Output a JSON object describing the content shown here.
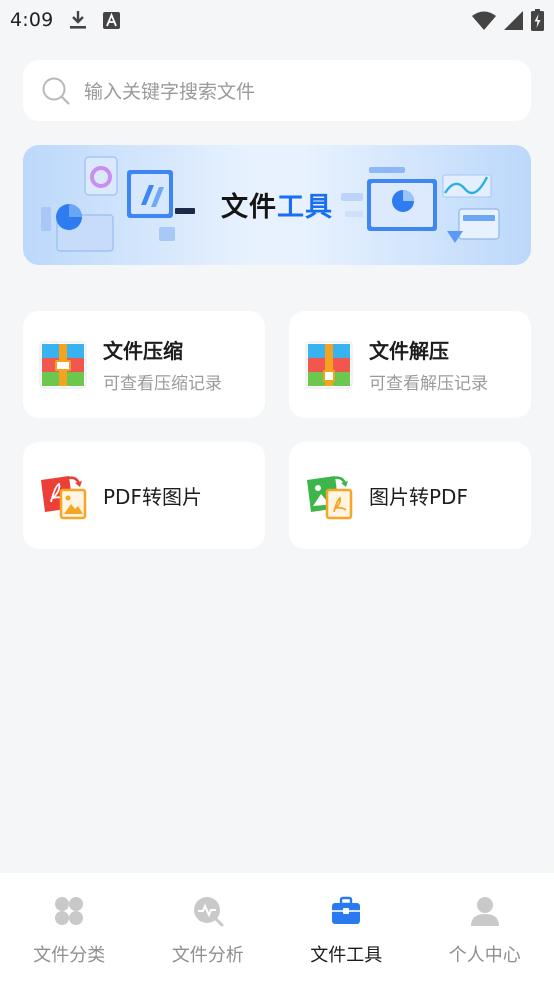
{
  "status_bar": {
    "time": "4:09",
    "icons": [
      "download-icon",
      "a-badge-icon",
      "wifi-icon",
      "signal-icon",
      "battery-charging-icon"
    ]
  },
  "search": {
    "placeholder": "输入关键字搜索文件"
  },
  "banner": {
    "title_part1": "文件",
    "title_part2": "工具"
  },
  "tools": [
    {
      "title": "文件压缩",
      "subtitle": "可查看压缩记录",
      "icon": "archive-compress-icon"
    },
    {
      "title": "文件解压",
      "subtitle": "可查看解压记录",
      "icon": "archive-extract-icon"
    },
    {
      "title": "PDF转图片",
      "icon": "pdf-to-image-icon"
    },
    {
      "title": "图片转PDF",
      "icon": "image-to-pdf-icon"
    }
  ],
  "nav": {
    "active": "文件工具",
    "items": [
      {
        "label": "文件分类",
        "icon": "category-grid-icon"
      },
      {
        "label": "文件分析",
        "icon": "analysis-icon"
      },
      {
        "label": "文件工具",
        "icon": "toolbox-icon"
      },
      {
        "label": "个人中心",
        "icon": "person-icon"
      }
    ]
  },
  "colors": {
    "accent": "#1a6ff0",
    "background": "#f5f6f8",
    "card": "#ffffff",
    "muted_text": "#9b9b9b"
  }
}
